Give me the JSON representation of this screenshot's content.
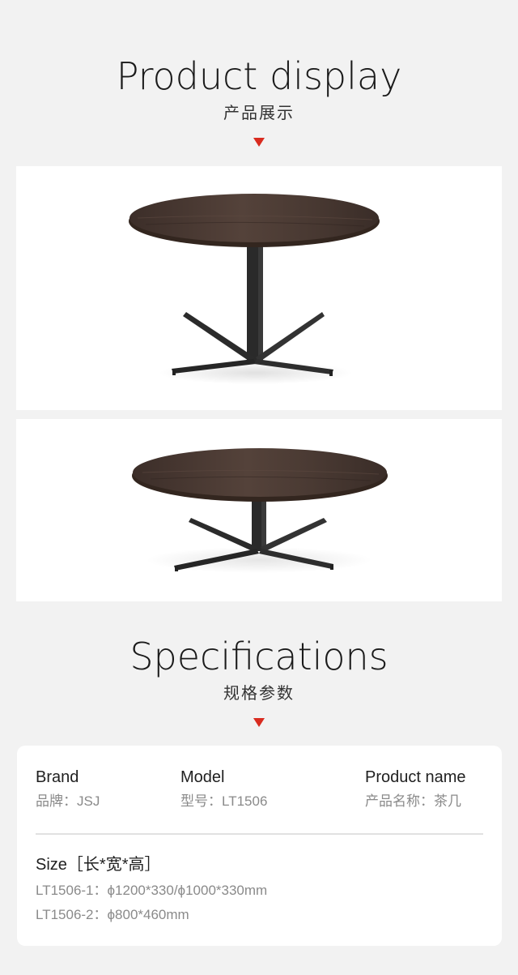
{
  "display": {
    "title_en": "Product display",
    "title_cn": "产品展示"
  },
  "specs": {
    "title_en": "Specifications",
    "title_cn": "规格参数",
    "brand": {
      "label": "Brand",
      "value": "品牌：JSJ"
    },
    "model": {
      "label": "Model",
      "value": "型号：LT1506"
    },
    "product_name": {
      "label": "Product name",
      "value": "产品名称：茶几"
    },
    "size": {
      "label": "Size［长*宽*高］",
      "lines": [
        "LT1506-1：ϕ1200*330/ϕ1000*330mm",
        "LT1506-2：ϕ800*460mm"
      ]
    }
  },
  "colors": {
    "accent": "#d92b1f",
    "background": "#f2f2f2",
    "card": "#ffffff",
    "wood": "#4a3a33",
    "metal": "#2b2b2b"
  }
}
